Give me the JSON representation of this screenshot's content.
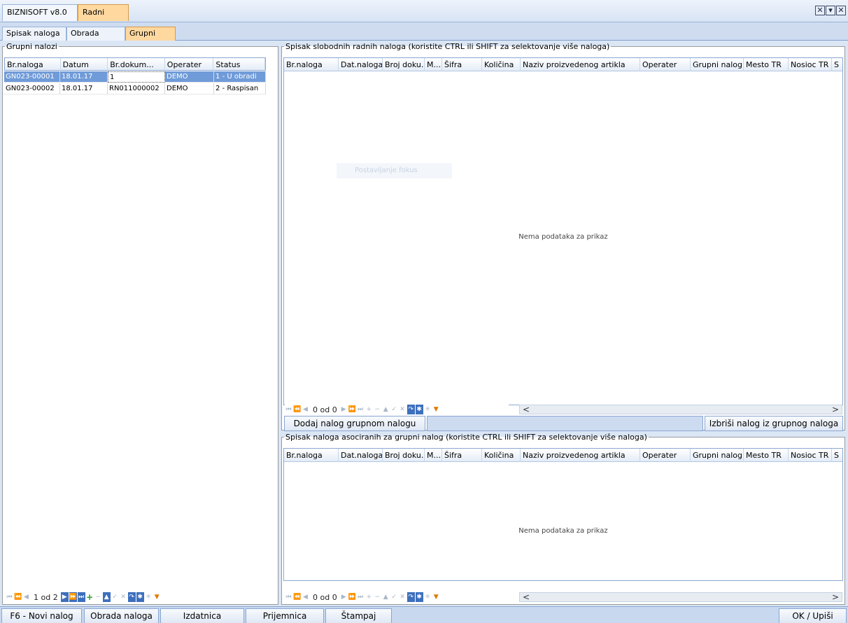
{
  "app": {
    "title_tab": "BIZNISOFT v8.0",
    "module_tab": "Radni nalog",
    "window_buttons": [
      "close-icon",
      "minimize-icon",
      "exit-icon"
    ]
  },
  "tabs": [
    "Spisak naloga",
    "Obrada naloga",
    "Grupni nalog"
  ],
  "left_group": {
    "legend": "Grupni nalozi",
    "columns": [
      "Br.naloga",
      "Datum",
      "Br.dokum...",
      "Operater",
      "Status"
    ],
    "rows": [
      [
        "GN023-00001",
        "18.01.17",
        "1",
        "DEMO",
        "1 - U obradi"
      ],
      [
        "GN023-00002",
        "18.01.17",
        "RN011000002",
        "DEMO",
        "2 - Raspisan"
      ]
    ],
    "nav_text": "1 od 2"
  },
  "free_orders": {
    "legend": "Spisak slobodnih radnih naloga (koristite CTRL ili SHIFT za selektovanje više naloga)",
    "columns": [
      "Br.naloga",
      "Dat.naloga",
      "Broj doku...",
      "M...",
      "Šifra",
      "Količina",
      "Naziv proizvedenog artikla",
      "Operater",
      "Grupni nalog",
      "Mesto TR",
      "Nosioc TR",
      "S"
    ],
    "empty_text": "Nema podataka za prikaz",
    "nav_text": "0 od 0",
    "scroll_left": "<",
    "scroll_right": ">",
    "ghost_text": "Postavljanje fokus"
  },
  "buttons": {
    "add": "Dodaj nalog grupnom nalogu",
    "remove": "Izbriši nalog iz grupnog naloga"
  },
  "assoc_orders": {
    "legend": "Spisak naloga asociranih za grupni nalog (koristite CTRL ili SHIFT za selektovanje više naloga)",
    "columns": [
      "Br.naloga",
      "Dat.naloga",
      "Broj doku...",
      "M...",
      "Šifra",
      "Količina",
      "Naziv proizvedenog artikla",
      "Operater",
      "Grupni nalog",
      "Mesto TR",
      "Nosioc TR",
      "S"
    ],
    "empty_text": "Nema podataka za prikaz",
    "nav_text": "0 od 0",
    "scroll_left": "<",
    "scroll_right": ">"
  },
  "bottom": {
    "new": "F6 - Novi nalog",
    "process": "Obrada naloga",
    "issue": "Izdatnica materijala",
    "receipt": "Prijemnica proizvoda",
    "print": "Štampaj",
    "ok": "OK / Upiši"
  }
}
